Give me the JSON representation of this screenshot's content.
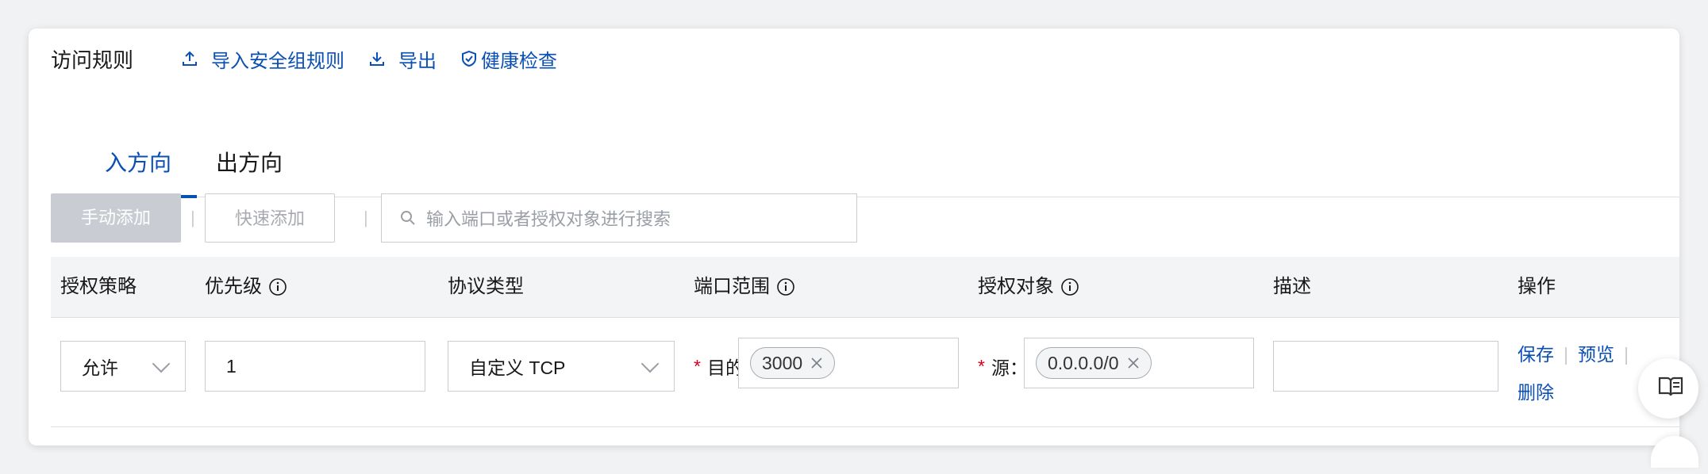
{
  "header": {
    "title": "访问规则",
    "import_label": "导入安全组规则",
    "export_label": "导出",
    "health_label": "健康检查"
  },
  "tabs": [
    {
      "label": "入方向",
      "active": true
    },
    {
      "label": "出方向",
      "active": false
    }
  ],
  "toolbar": {
    "manual_add": "手动添加",
    "quick_add": "快速添加",
    "separator": "|",
    "search_placeholder": "输入端口或者授权对象进行搜索"
  },
  "table": {
    "columns": [
      "授权策略",
      "优先级",
      "协议类型",
      "端口范围",
      "授权对象",
      "描述",
      "操作"
    ],
    "row": {
      "policy": "允许",
      "priority": "1",
      "protocol": "自定义 TCP",
      "port_required": "*",
      "port_label": "目的",
      "port_tag": "3000",
      "source_required": "*",
      "source_label": "源：",
      "source_tag": "0.0.0.0/0",
      "description": "",
      "actions": {
        "save": "保存",
        "preview": "预览",
        "delete": "删除"
      }
    }
  },
  "colors": {
    "accent": "#0a4fb4",
    "required": "#d0021b",
    "disabled_button": "#c9ccd2",
    "header_bg": "#f3f4f6"
  },
  "icons": [
    "upload-icon",
    "download-icon",
    "shield-check-icon",
    "search-icon",
    "info-icon",
    "close-icon",
    "chevron-down-icon",
    "book-icon"
  ]
}
